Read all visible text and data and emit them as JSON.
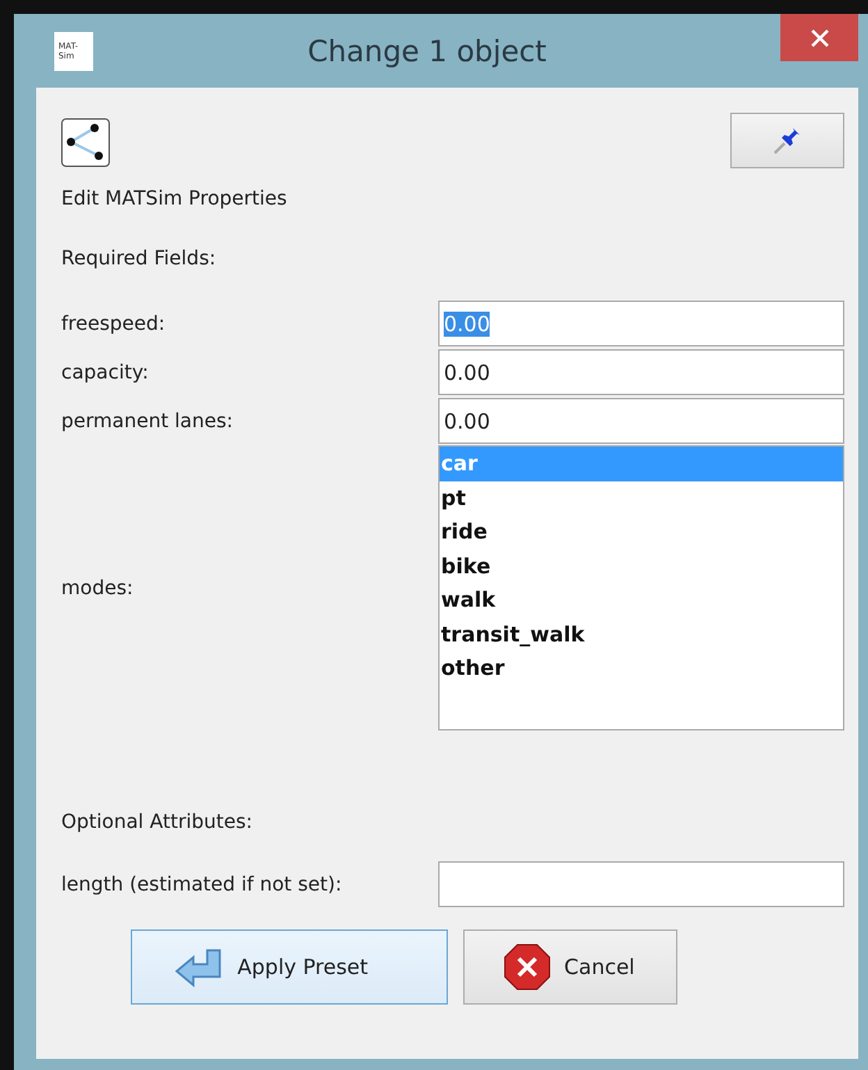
{
  "window": {
    "title": "Change 1 object",
    "app_icon_lines": [
      "MAT-",
      "Sim"
    ]
  },
  "header": {
    "caption": "Edit MATSim Properties"
  },
  "required_heading": "Required Fields:",
  "fields": [
    {
      "label": "freespeed:",
      "value": "0.00",
      "text_selected": true
    },
    {
      "label": "capacity:",
      "value": "0.00",
      "text_selected": false
    },
    {
      "label": "permanent lanes:",
      "value": "0.00",
      "text_selected": false
    }
  ],
  "modes": {
    "label": "modes:",
    "items": [
      {
        "label": "car",
        "selected": true
      },
      {
        "label": "pt",
        "selected": false
      },
      {
        "label": "ride",
        "selected": false
      },
      {
        "label": "bike",
        "selected": false
      },
      {
        "label": "walk",
        "selected": false
      },
      {
        "label": "transit_walk",
        "selected": false
      },
      {
        "label": "other",
        "selected": false
      }
    ]
  },
  "optional_heading": "Optional Attributes:",
  "optional_fields": [
    {
      "label": "length (estimated if not set):"
    }
  ],
  "buttons": [
    {
      "kind": "apply",
      "label": "Apply Preset"
    },
    {
      "kind": "cancel",
      "label": "Cancel"
    }
  ]
}
